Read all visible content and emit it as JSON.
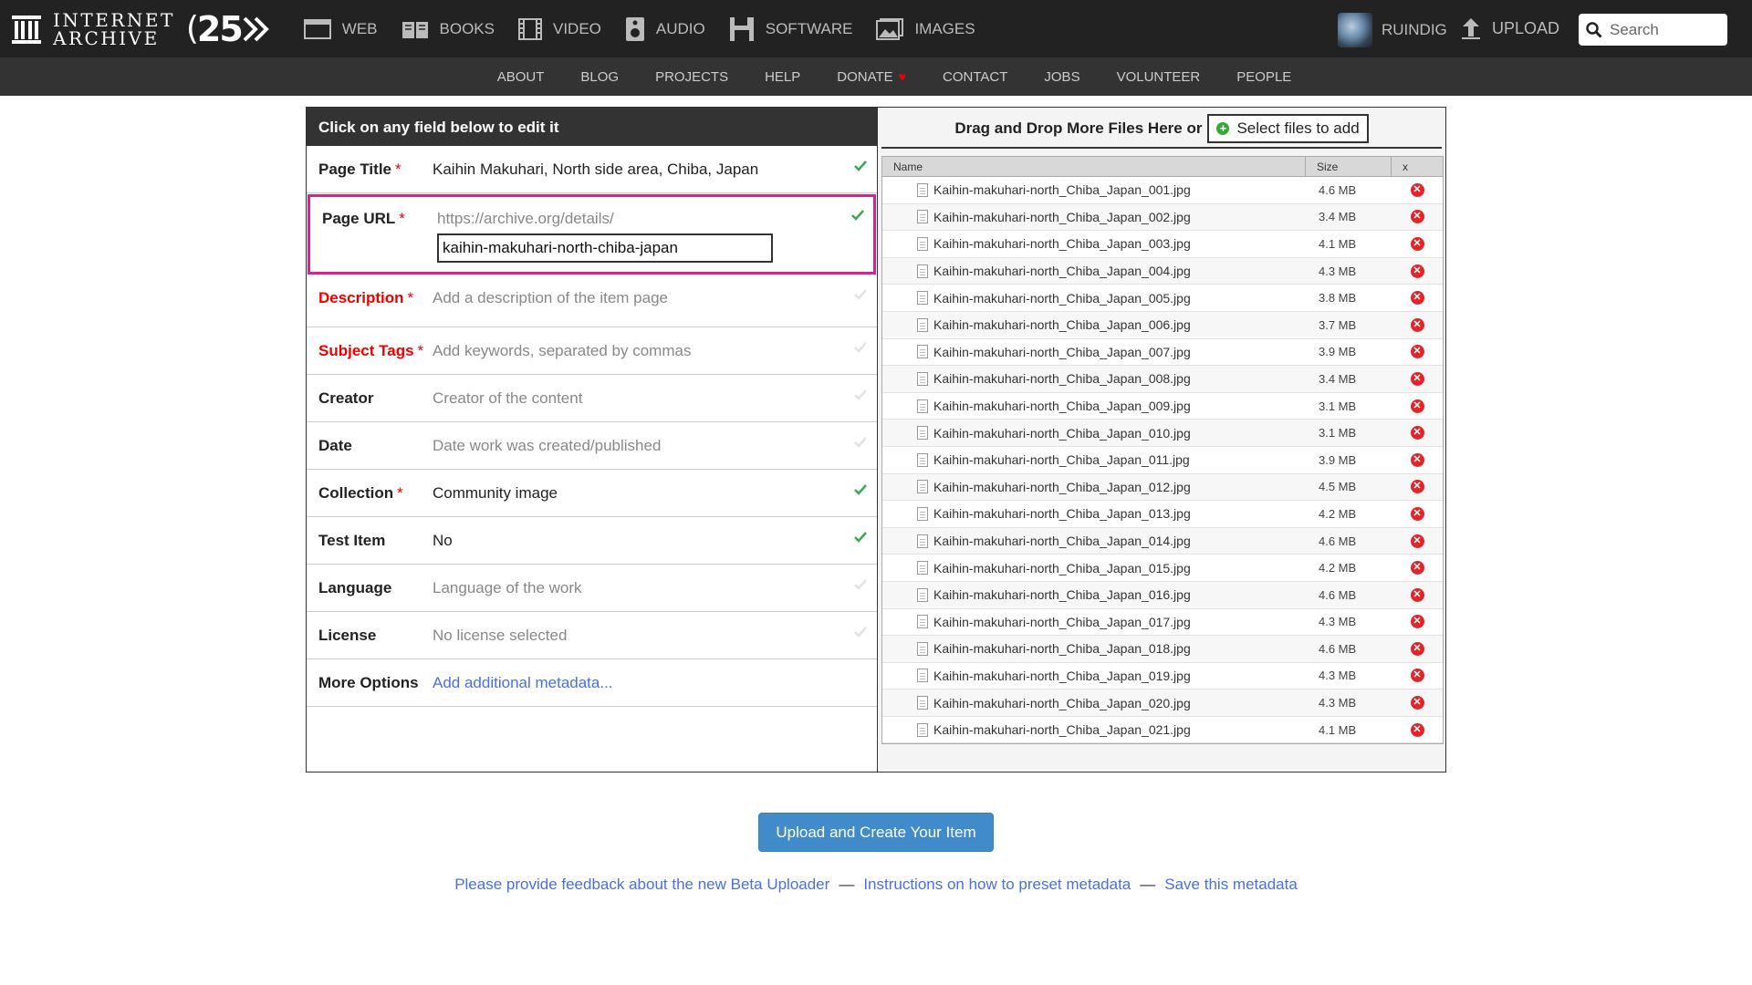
{
  "header": {
    "logo_line1": "INTERNET",
    "logo_line2": "ARCHIVE",
    "logo_25": "25",
    "media": [
      {
        "label": "WEB",
        "icon": "web-icon"
      },
      {
        "label": "BOOKS",
        "icon": "books-icon"
      },
      {
        "label": "VIDEO",
        "icon": "video-icon"
      },
      {
        "label": "AUDIO",
        "icon": "audio-icon"
      },
      {
        "label": "SOFTWARE",
        "icon": "software-icon"
      },
      {
        "label": "IMAGES",
        "icon": "images-icon"
      }
    ],
    "username": "RUINDIG",
    "upload_label": "UPLOAD",
    "search_placeholder": "Search"
  },
  "subnav": [
    "ABOUT",
    "BLOG",
    "PROJECTS",
    "HELP",
    "DONATE",
    "CONTACT",
    "JOBS",
    "VOLUNTEER",
    "PEOPLE"
  ],
  "form": {
    "heading": "Click on any field below to edit it",
    "page_title": {
      "label": "Page Title",
      "value": "Kaihin Makuhari, North side area, Chiba, Japan"
    },
    "page_url": {
      "label": "Page URL",
      "prefix": "https://archive.org/details/",
      "value": "kaihin-makuhari-north-chiba-japan"
    },
    "description": {
      "label": "Description",
      "placeholder": "Add a description of the item page"
    },
    "subject_tags": {
      "label": "Subject Tags",
      "placeholder": "Add keywords, separated by commas"
    },
    "creator": {
      "label": "Creator",
      "placeholder": "Creator of the content"
    },
    "date": {
      "label": "Date",
      "placeholder": "Date work was created/published"
    },
    "collection": {
      "label": "Collection",
      "value": "Community image"
    },
    "test_item": {
      "label": "Test Item",
      "value": "No"
    },
    "language": {
      "label": "Language",
      "placeholder": "Language of the work"
    },
    "license": {
      "label": "License",
      "placeholder": "No license selected"
    },
    "more_options": {
      "label": "More Options",
      "link": "Add additional metadata..."
    },
    "required_mark": "*"
  },
  "files_panel": {
    "drag_text": "Drag and Drop More Files Here or",
    "select_label": "Select files to add",
    "col_name": "Name",
    "col_size": "Size",
    "col_x": "x",
    "files": [
      {
        "name": "Kaihin-makuhari-north_Chiba_Japan_001.jpg",
        "size": "4.6 MB"
      },
      {
        "name": "Kaihin-makuhari-north_Chiba_Japan_002.jpg",
        "size": "3.4 MB"
      },
      {
        "name": "Kaihin-makuhari-north_Chiba_Japan_003.jpg",
        "size": "4.1 MB"
      },
      {
        "name": "Kaihin-makuhari-north_Chiba_Japan_004.jpg",
        "size": "4.3 MB"
      },
      {
        "name": "Kaihin-makuhari-north_Chiba_Japan_005.jpg",
        "size": "3.8 MB"
      },
      {
        "name": "Kaihin-makuhari-north_Chiba_Japan_006.jpg",
        "size": "3.7 MB"
      },
      {
        "name": "Kaihin-makuhari-north_Chiba_Japan_007.jpg",
        "size": "3.9 MB"
      },
      {
        "name": "Kaihin-makuhari-north_Chiba_Japan_008.jpg",
        "size": "3.4 MB"
      },
      {
        "name": "Kaihin-makuhari-north_Chiba_Japan_009.jpg",
        "size": "3.1 MB"
      },
      {
        "name": "Kaihin-makuhari-north_Chiba_Japan_010.jpg",
        "size": "3.1 MB"
      },
      {
        "name": "Kaihin-makuhari-north_Chiba_Japan_011.jpg",
        "size": "3.9 MB"
      },
      {
        "name": "Kaihin-makuhari-north_Chiba_Japan_012.jpg",
        "size": "4.5 MB"
      },
      {
        "name": "Kaihin-makuhari-north_Chiba_Japan_013.jpg",
        "size": "4.2 MB"
      },
      {
        "name": "Kaihin-makuhari-north_Chiba_Japan_014.jpg",
        "size": "4.6 MB"
      },
      {
        "name": "Kaihin-makuhari-north_Chiba_Japan_015.jpg",
        "size": "4.2 MB"
      },
      {
        "name": "Kaihin-makuhari-north_Chiba_Japan_016.jpg",
        "size": "4.6 MB"
      },
      {
        "name": "Kaihin-makuhari-north_Chiba_Japan_017.jpg",
        "size": "4.3 MB"
      },
      {
        "name": "Kaihin-makuhari-north_Chiba_Japan_018.jpg",
        "size": "4.6 MB"
      },
      {
        "name": "Kaihin-makuhari-north_Chiba_Japan_019.jpg",
        "size": "4.3 MB"
      },
      {
        "name": "Kaihin-makuhari-north_Chiba_Japan_020.jpg",
        "size": "4.3 MB"
      },
      {
        "name": "Kaihin-makuhari-north_Chiba_Japan_021.jpg",
        "size": "4.1 MB"
      }
    ]
  },
  "actions": {
    "upload_button": "Upload and Create Your Item"
  },
  "footer": {
    "feedback": "Please provide feedback about the new Beta Uploader",
    "instructions": "Instructions on how to preset metadata",
    "save": "Save this metadata",
    "separator": "—"
  },
  "colors": {
    "topbar": "#222222",
    "subnav": "#333333",
    "url_highlight": "#d9218f",
    "required": "#ee0000",
    "check": "#3aa85a",
    "link": "#4a6fe0",
    "upload_button": "#428bca",
    "remove": "#e0262a"
  }
}
